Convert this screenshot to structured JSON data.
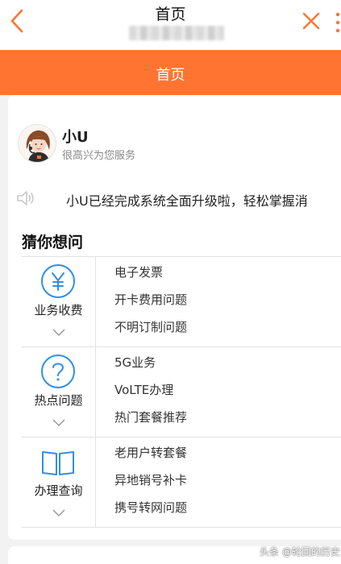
{
  "topbar": {
    "title": "首页",
    "back_icon": "chevron-left-icon",
    "close_icon": "close-icon",
    "accent_color": "#ff7430"
  },
  "header": {
    "title": "首页",
    "background": "#ff7430"
  },
  "assistant": {
    "name": "小U",
    "subtitle": "很高兴为您服务"
  },
  "notice": {
    "icon": "speaker-icon",
    "text": "小U已经完成系统全面升级啦，轻松掌握消"
  },
  "faq": {
    "title": "猜你想问",
    "categories": [
      {
        "label": "业务收费",
        "icon": "yen-icon",
        "questions": [
          "电子发票",
          "开卡费用问题",
          "不明订制问题"
        ]
      },
      {
        "label": "热点问题",
        "icon": "question-icon",
        "questions": [
          "5G业务",
          "VoLTE办理",
          "热门套餐推荐"
        ]
      },
      {
        "label": "办理查询",
        "icon": "book-icon",
        "questions": [
          "老用户转套餐",
          "异地销号补卡",
          "携号转网问题"
        ]
      }
    ]
  },
  "watermark": "头条 @轮回的历史"
}
